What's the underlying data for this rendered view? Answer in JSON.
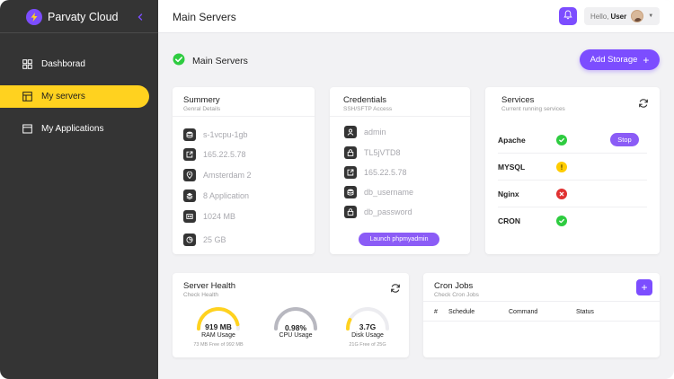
{
  "app": {
    "name": "Parvaty Cloud"
  },
  "colors": {
    "accent": "#7c4dff",
    "active_nav": "#ffd21f",
    "sidebar": "#343434",
    "ok": "#2ecc40",
    "warn": "#ffcc00",
    "error": "#e03131"
  },
  "sidebar": {
    "items": [
      {
        "label": "Dashborad",
        "icon": "dashboard-icon",
        "active": false
      },
      {
        "label": "My servers",
        "icon": "server-icon",
        "active": true
      },
      {
        "label": "My Applications",
        "icon": "window-icon",
        "active": false
      }
    ]
  },
  "header": {
    "title": "Main Servers",
    "greeting": "Hello,",
    "user": "User"
  },
  "page": {
    "title": "Main Servers",
    "status_icon": "check-circle-icon",
    "add_storage_label": "Add Storage",
    "add_storage_plus": "+"
  },
  "summary": {
    "title": "Summery",
    "subtitle": "Genral Details",
    "rows": [
      {
        "icon": "database-icon",
        "text": "s-1vcpu-1gb"
      },
      {
        "icon": "external-link-icon",
        "text": "165.22.5.78"
      },
      {
        "icon": "location-icon",
        "text": "Amsterdam 2"
      },
      {
        "icon": "layers-icon",
        "text": "8 Application"
      },
      {
        "icon": "memory-icon",
        "text": "1024 MB"
      },
      {
        "icon": "pie-icon",
        "text": "25 GB"
      }
    ]
  },
  "credentials": {
    "title": "Credentials",
    "subtitle": "SSH/SFTP Access",
    "rows": [
      {
        "icon": "user-icon",
        "text": "admin"
      },
      {
        "icon": "lock-icon",
        "text": "TL5jVTD8"
      },
      {
        "icon": "external-link-icon",
        "text": "165.22.5.78"
      },
      {
        "icon": "database-icon",
        "text": "db_username"
      },
      {
        "icon": "lock-icon",
        "text": "db_password"
      }
    ],
    "launch_label": "Launch phpmyadmin"
  },
  "services": {
    "title": "Services",
    "subtitle": "Current running services",
    "rows": [
      {
        "name": "Apache",
        "status": "ok",
        "action": "Stop"
      },
      {
        "name": "MYSQL",
        "status": "warn"
      },
      {
        "name": "Nginx",
        "status": "error"
      },
      {
        "name": "CRON",
        "status": "ok"
      }
    ]
  },
  "health": {
    "title": "Server Health",
    "subtitle": "Check Health",
    "gauges": [
      {
        "value": "919 MB",
        "label": "RAM Usage",
        "sub": "73 MB Free of 992 MB",
        "fraction": 0.93,
        "color": "#ffd21f"
      },
      {
        "value": "0.98%",
        "label": "CPU Usage",
        "sub": "",
        "fraction": 0.0098,
        "color": "#b8b8c0"
      },
      {
        "value": "3.7G",
        "label": "Disk Usage",
        "sub": "21G Free of 25G",
        "fraction": 0.15,
        "color": "#ffd21f"
      }
    ]
  },
  "cron": {
    "title": "Cron Jobs",
    "subtitle": "Check Cron Jobs",
    "add_label": "+",
    "columns": [
      "#",
      "Schedule",
      "Command",
      "Status"
    ]
  }
}
